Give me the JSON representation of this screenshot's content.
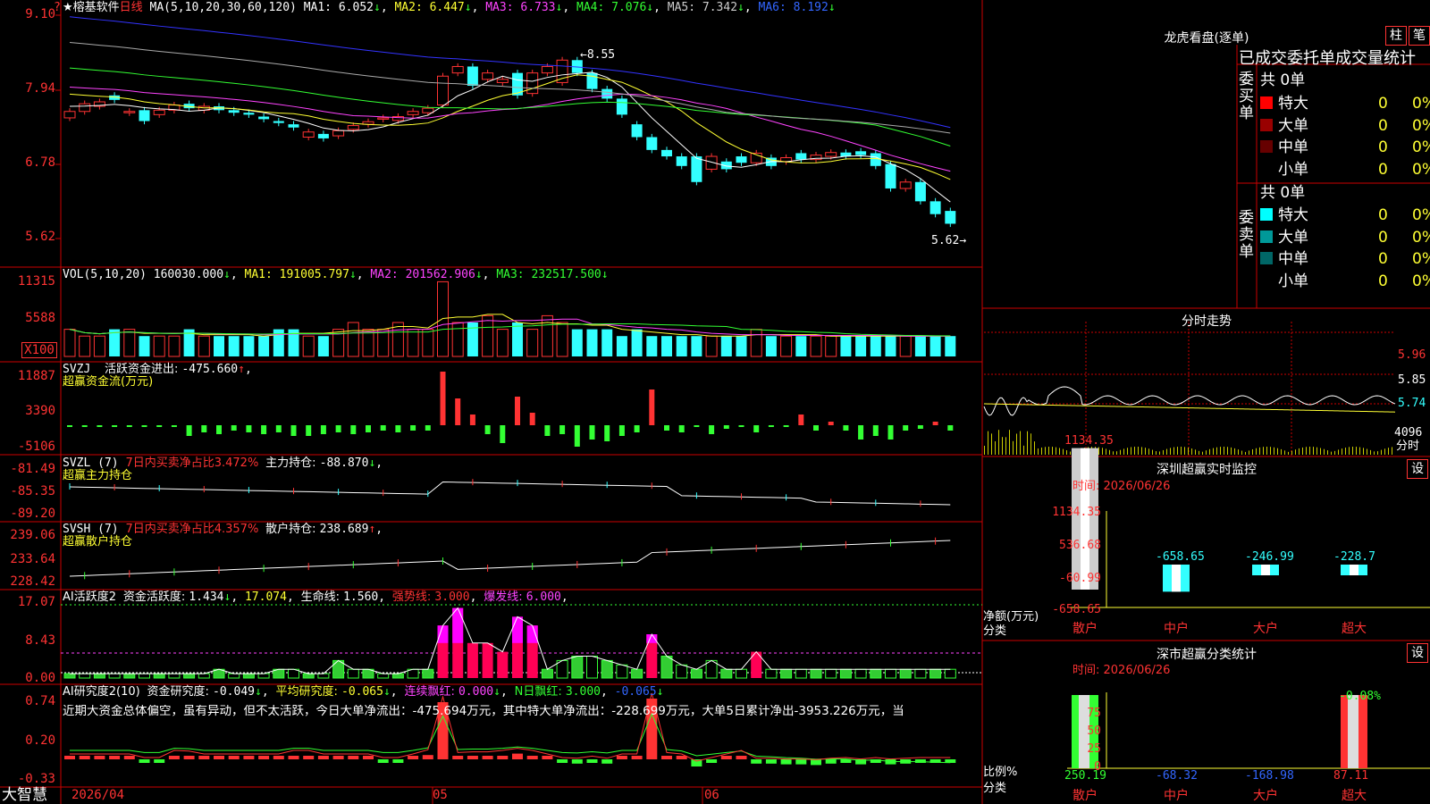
{
  "app": {
    "brand": "★榕基软件",
    "period": "日线",
    "corner_mark": "?",
    "footer_logo": "大智慧"
  },
  "colors": {
    "up": "#ff3333",
    "down": "#33ffff",
    "ma1": "#ffffff",
    "ma2": "#ffff33",
    "ma3": "#ff44ff",
    "ma4": "#33ff33",
    "ma5": "#aaaaaa",
    "ma6": "#3333ff",
    "grid": "#cc0000"
  },
  "price_panel": {
    "ma_name": "MA(5,10,20,30,60,120)",
    "ma_items": [
      {
        "label": "MA1: ",
        "value": "6.052",
        "arrow": "↓"
      },
      {
        "label": "MA2: ",
        "value": "6.447",
        "arrow": "↓"
      },
      {
        "label": "MA3: ",
        "value": "6.733",
        "arrow": "↓"
      },
      {
        "label": "MA4: ",
        "value": "7.076",
        "arrow": "↓"
      },
      {
        "label": "MA5: ",
        "value": "7.342",
        "arrow": "↓"
      },
      {
        "label": "MA6: ",
        "value": "8.192",
        "arrow": "↓"
      }
    ],
    "y_ticks": [
      "9.10",
      "7.94",
      "6.78",
      "5.62"
    ],
    "high_label": "8.55",
    "low_label": "5.62"
  },
  "vol_panel": {
    "title": "VOL(5,10,20)",
    "value": "160030.000",
    "arrow": "↓",
    "items": [
      {
        "label": "MA1: ",
        "value": "191005.797",
        "arrow": "↓"
      },
      {
        "label": "MA2: ",
        "value": "201562.906",
        "arrow": "↓"
      },
      {
        "label": "MA3: ",
        "value": "232517.500",
        "arrow": "↓"
      }
    ],
    "y_ticks": [
      "11315",
      "5588",
      "X100"
    ]
  },
  "svzj_panel": {
    "title": "SVZJ",
    "label": "活跃资金进出: ",
    "value": "-475.660",
    "arrow": "↑",
    "subtitle": "超赢资金流(万元)",
    "y_ticks": [
      "11887",
      "3390",
      "-5106"
    ]
  },
  "svzl_panel": {
    "title": "SVZL (7)",
    "ratio_text": "7日内买卖净占比3.472%",
    "label": "主力持仓: ",
    "value": "-88.870",
    "arrow": "↓",
    "subtitle": "超赢主力持仓",
    "y_ticks": [
      "-81.49",
      "-85.35",
      "-89.20"
    ]
  },
  "svsh_panel": {
    "title": "SVSH (7)",
    "ratio_text": "7日内买卖净占比4.357%",
    "label": "散户持仓: ",
    "value": "238.689",
    "arrow": "↑",
    "subtitle": "超赢散户持仓",
    "y_ticks": [
      "239.06",
      "233.64",
      "228.42"
    ]
  },
  "ai_active_panel": {
    "title": "AI活跃度2",
    "label": "资金活跃度: ",
    "value": "1.434",
    "arrow": "↓",
    "value2": "17.074",
    "life_label": "生命线: ",
    "life_value": "1.560",
    "strong_label": "强势线: ",
    "strong_value": "3.000",
    "burst_label": "爆发线: ",
    "burst_value": "6.000",
    "y_ticks": [
      "17.07",
      "8.43",
      "0.00"
    ]
  },
  "ai_research_panel": {
    "title": "AI研究度2(10)",
    "label": "资金研究度: ",
    "value": "-0.049",
    "arrow": "↓",
    "avg_label": "平均研究度: ",
    "avg_value": "-0.065",
    "avg_arrow": "↓",
    "red_label": "连续飘红: ",
    "red_value": "0.000",
    "red_arrow": "↓",
    "n_label": "N日飘红: ",
    "n_value": "3.000",
    "n_value2": "-0.065",
    "n_arrow": "↓",
    "commentary": "近期大资金总体偏空，虽有异动，但不太活跃，今日大单净流出：-475.694万元，其中特大单净流出：-228.699万元，大单5日累计净出-3953.226万元，当",
    "y_ticks": [
      "0.74",
      "0.20",
      "-0.33"
    ]
  },
  "x_axis": {
    "labels": [
      "2026/04",
      "05",
      "06"
    ]
  },
  "dragon_tiger": {
    "title": "龙虎看盘(逐单)",
    "btn_bar": "柱",
    "btn_pen": "笔",
    "header": "已成交委托单成交量统计",
    "buy": {
      "side_label": "委买单",
      "total": "共 0单",
      "rows": [
        {
          "label": "特大",
          "count": "0",
          "pct": "0%",
          "color": "#ff0000"
        },
        {
          "label": "大单",
          "count": "0",
          "pct": "0%",
          "color": "#990000"
        },
        {
          "label": "中单",
          "count": "0",
          "pct": "0%",
          "color": "#660000"
        },
        {
          "label": "小单",
          "count": "0",
          "pct": "0%",
          "color": ""
        }
      ]
    },
    "sell": {
      "side_label": "委卖单",
      "total": "共 0单",
      "rows": [
        {
          "label": "特大",
          "count": "0",
          "pct": "0%",
          "color": "#00ffff"
        },
        {
          "label": "大单",
          "count": "0",
          "pct": "0%",
          "color": "#009999"
        },
        {
          "label": "中单",
          "count": "0",
          "pct": "0%",
          "color": "#006666"
        },
        {
          "label": "小单",
          "count": "0",
          "pct": "0%",
          "color": ""
        }
      ]
    }
  },
  "intraday": {
    "title": "分时走势",
    "y_ticks": [
      "5.96",
      "5.85",
      "5.74"
    ],
    "vol_label": "4096",
    "unit_label": "分时"
  },
  "monitor": {
    "title": "深圳超赢实时监控",
    "btn": "设",
    "time": "时间: 2026/06/26",
    "y_ticks": [
      "1134.35",
      "536.68",
      "-60.99",
      "-658.65"
    ],
    "y_unit": "净额(万元)",
    "x_caption": "分类",
    "chart_data": {
      "type": "bar",
      "categories": [
        "散户",
        "中户",
        "大户",
        "超大"
      ],
      "values": [
        1134.35,
        -658.65,
        -246.99,
        -228.7
      ],
      "ylim": [
        -658.65,
        1134.35
      ],
      "colors": [
        "#ffffff",
        "#33ffff",
        "#33ffff",
        "#33ffff"
      ]
    }
  },
  "classify": {
    "title": "深市超赢分类统计",
    "btn": "设",
    "time": "时间: 2026/06/26",
    "y_ticks": [
      "75",
      "50",
      "25",
      "0"
    ],
    "y_unit": "比例%",
    "x_caption": "分类",
    "top_label": "-0.08%",
    "chart_data": {
      "type": "bar",
      "categories": [
        "散户",
        "中户",
        "大户",
        "超大"
      ],
      "values": [
        250.19,
        -68.32,
        -168.98,
        87.11
      ],
      "ylim": [
        0,
        100
      ]
    }
  }
}
